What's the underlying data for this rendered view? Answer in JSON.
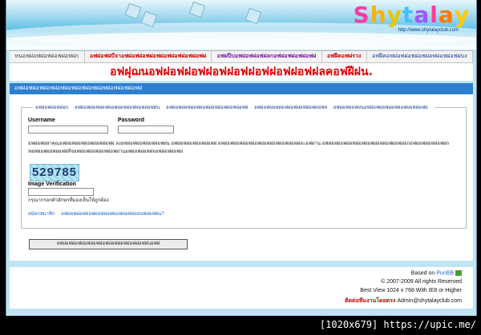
{
  "header": {
    "logo_text": "Shytalay",
    "logo_url": "http://www.shytalayclub.com",
    "logo_colors": [
      "#ff3aa0",
      "#ffb000",
      "#ffe000",
      "#3ec0ff",
      "#9b59ff",
      "#ff3aa0",
      "#ff7a00",
      "#ffcc00"
    ]
  },
  "nav": {
    "items": [
      {
        "label": "หนอฟฝอฟฝอฟฝอฟฝอฟฝก",
        "style": "normal"
      },
      {
        "label": "อฟฝอฟฝบีจาอฟฝอฟฝอฟฝอฟฝอฟฝอฟฝอฟฝอฟฝ",
        "style": "hl"
      },
      {
        "label": "อฟฝปีบอฟฝอฟฝอฟฝลกอฟฝอฟฝอฟฝอฟฝ",
        "style": "pl"
      },
      {
        "label": "อฟฝีคอฟฝรวง",
        "style": "hl"
      },
      {
        "label": "อฟฝีคอฟฝอฟฝอฟฝอฟฝอฟฝอฟฝอฟฝบง",
        "style": "normal"
      }
    ]
  },
  "marquee": {
    "text": "อฟฝุฌนอฟฝอฟฝอฟฝอฟฝอฟฝอฟฝอฟฝอฟฝลคอฟฝีฝน."
  },
  "panel": {
    "title": "อฟฝอฟฝอฟฝอฟฝอฟฝอฟฝอฟฝอฟฝอฟฝอฟฝอฟฝอฟฝ",
    "legend_links": [
      "อฟฝอฟฝอฟฝอก",
      "อฟฝอฟฝอฟฝอฟฝอฟฝอฟฝอฟฝอฟฝอฟฝน",
      "อฟฝอฟฝอฟฝอฟฝอฟฝอฟฝอฟฝอฟฝอฟฝ",
      "อฟฝอฟฝอฟฝอฟฝอฟฝอฟฝอฟฝอฟฝ",
      "อฟฝอฟฝอฟฝนอฟฝอฟฝอฟฝอฟฝอฟฝอฟฝอฟฝ"
    ],
    "username_label": "Username",
    "password_label": "Password",
    "username_value": "",
    "password_value": "",
    "info_line1": "อฟฝอฟฝสาคุณอฟฝอฟฝอฟฝอฟฝอฟฝอฟฝ  ลงอฟฝอฟฝอฟฝอฟฝอฟฝน   อฟฝอฟฝอฟฝอฟฝอฟฝ   อฟฝอฟฝอฟฝอฟฝอฟฝอฟฝอฟฝอฟฝอฟฝละอฟฝาน   อฟฝอฟฝอฟฝอฟฝอฟฝอฟฝอฟฝอฟฝอฟฝอกอฟฝอฟฝอฟฝอฟฝก",
    "info_line2": "ทอฟฝอฟฝอฟฝอฟฝทีจอฟฝอฟฝอฟฝอฟฝอฟฝานอฟฝอฟฝอฟฝจอฟฝอฟฝอฟฝ",
    "captcha": "529785",
    "image_verification_label": "Image Verification",
    "verification_value": "",
    "hint": "กรุณากรอกตัวอักษรที่มองเห็นให้ถูกต้อง",
    "register_links": [
      "สมัครสมาชิก",
      "อฟฝอฟฝอฟฝอฟฝอฟฝอฟฝอฟฝอฟฝลสอฟฝอฟฝน?"
    ],
    "submit_label": "อฟฝอฟฝอฟฝอฟฝอฟฝอฟฝอฟฝอฟฝอฟฝอฟฝบอฟฝ"
  },
  "footer": {
    "based_on": "Based on",
    "punbb": "PunBB",
    "copyright": "© 2007-2009 All rights Reserved",
    "best_view": "Best View 1024 x 768 With IE8 or Higher",
    "contact_label": "ติดต่อทีมงานโดยตรง",
    "contact_email": "Admin@shytalayclub.com"
  },
  "watermark": {
    "text": "[1020x679] https://upic.me/"
  }
}
